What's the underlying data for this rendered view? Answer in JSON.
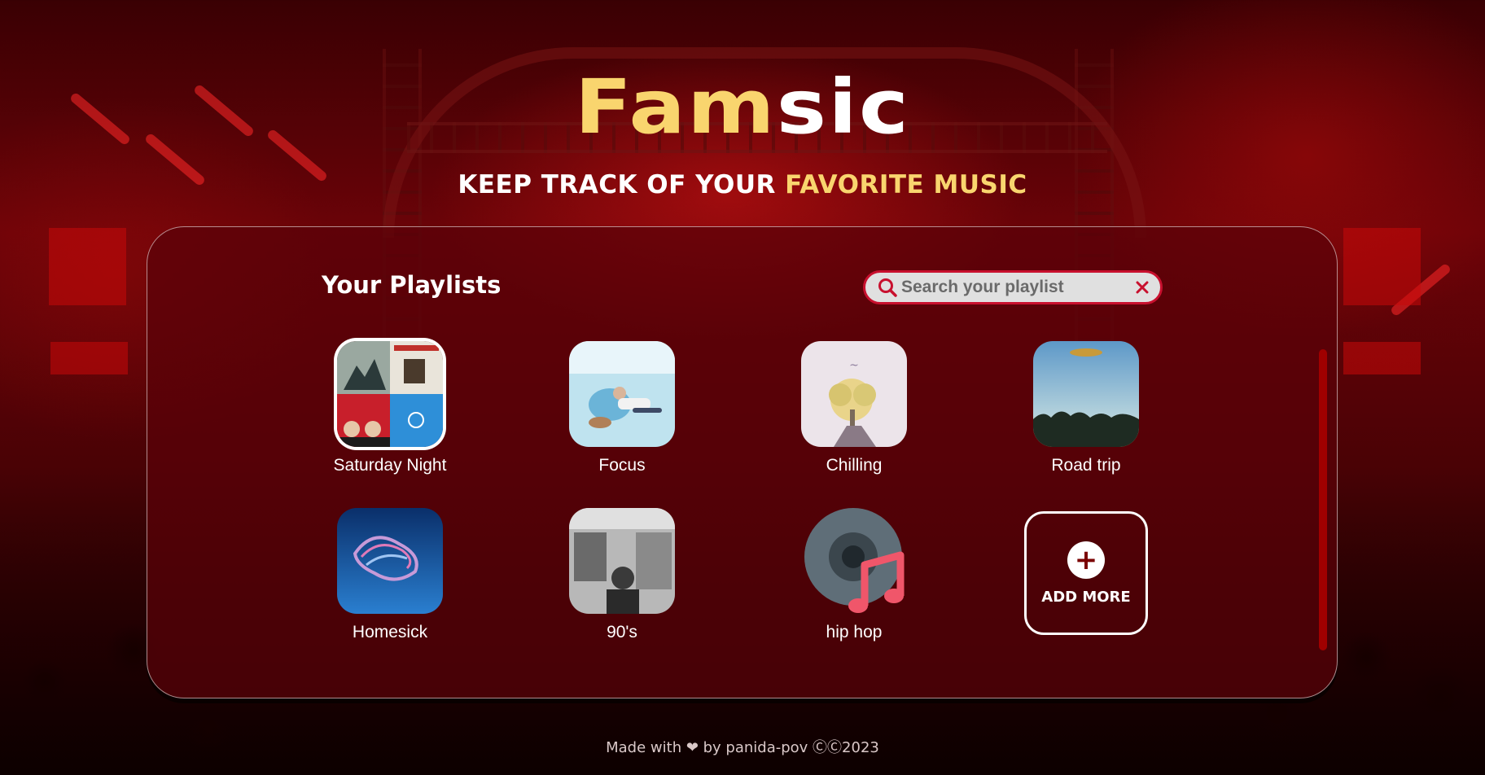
{
  "header": {
    "logo_part_a": "Fam",
    "logo_part_b": "sic",
    "tagline_lead": "KEEP TRACK OF YOUR ",
    "tagline_accent": "FAVORITE MUSIC"
  },
  "panel": {
    "title": "Your Playlists",
    "search": {
      "placeholder": "Search your playlist",
      "value": ""
    },
    "playlists": [
      {
        "label": "Saturday Night",
        "cover": "album-collage",
        "selected": true
      },
      {
        "label": "Focus",
        "cover": "person-with-guitar"
      },
      {
        "label": "Chilling",
        "cover": "tree-on-rock"
      },
      {
        "label": "Road trip",
        "cover": "landscape-sky"
      },
      {
        "label": "Homesick",
        "cover": "abstract-blue"
      },
      {
        "label": "90's",
        "cover": "black-white-photo"
      },
      {
        "label": "hip hop",
        "cover": "vinyl-music-note"
      }
    ],
    "add_more": {
      "icon": "plus-icon",
      "label": "ADD MORE"
    }
  },
  "footer": {
    "text": "Made with ❤ by panida-pov ⒸⒸ2023"
  },
  "colors": {
    "accent_yellow": "#f9d56e",
    "search_border": "#c8102e",
    "panel_bg": "#5a0208",
    "scrollbar": "#a00000"
  }
}
